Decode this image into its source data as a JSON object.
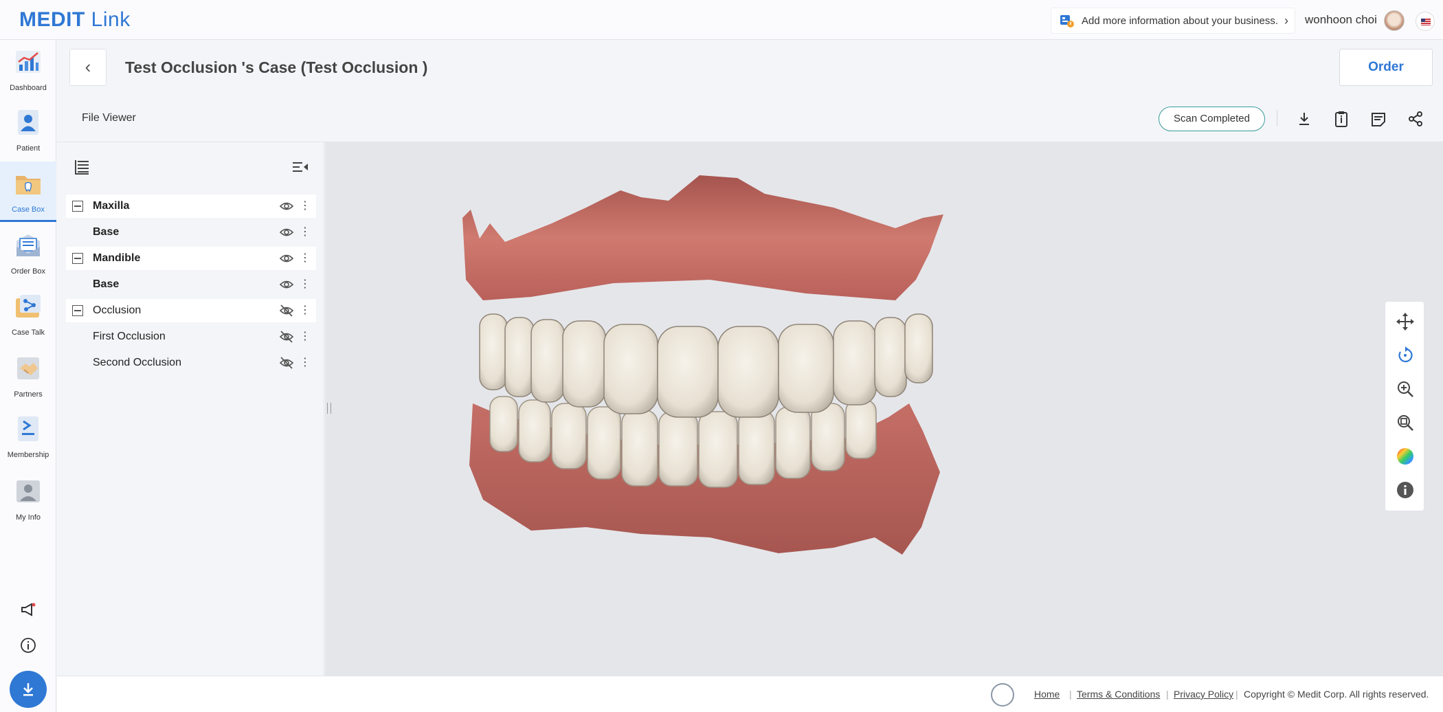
{
  "app": {
    "logo_bold": "MEDIT",
    "logo_light": "Link"
  },
  "topbar": {
    "banner_text": "Add more information about your business.",
    "username": "wonhoon choi"
  },
  "sidebar": {
    "items": [
      {
        "label": "Dashboard",
        "icon": "dashboard-chart-icon"
      },
      {
        "label": "Patient",
        "icon": "patient-icon"
      },
      {
        "label": "Case Box",
        "icon": "case-box-folder-icon"
      },
      {
        "label": "Order Box",
        "icon": "order-box-icon"
      },
      {
        "label": "Case Talk",
        "icon": "case-talk-icon"
      },
      {
        "label": "Partners",
        "icon": "partners-handshake-icon"
      },
      {
        "label": "Membership",
        "icon": "membership-icon"
      },
      {
        "label": "My Info",
        "icon": "my-info-icon"
      }
    ],
    "active": "Case Box"
  },
  "header": {
    "title": "Test Occlusion 's Case (Test Occlusion )",
    "order_label": "Order",
    "section_label": "File Viewer",
    "status": "Scan Completed"
  },
  "tree": [
    {
      "label": "Maxilla",
      "level": 0,
      "bold": true,
      "visible": true
    },
    {
      "label": "Base",
      "level": 1,
      "bold": true,
      "visible": true
    },
    {
      "label": "Mandible",
      "level": 0,
      "bold": true,
      "visible": true
    },
    {
      "label": "Base",
      "level": 1,
      "bold": true,
      "visible": true
    },
    {
      "label": "Occlusion",
      "level": 0,
      "bold": false,
      "visible": false
    },
    {
      "label": "First Occlusion",
      "level": 1,
      "bold": false,
      "visible": false
    },
    {
      "label": "Second Occlusion",
      "level": 1,
      "bold": false,
      "visible": false
    }
  ],
  "viewer_tools": [
    "pan-icon",
    "rotate-icon",
    "zoom-in-icon",
    "zoom-fit-icon",
    "color-map-icon",
    "info-icon"
  ],
  "footer": {
    "home": "Home",
    "terms": "Terms & Conditions",
    "privacy": "Privacy Policy",
    "copyright": "Copyright © Medit Corp. All rights reserved."
  },
  "colors": {
    "accent": "#2f78d4",
    "status_border": "#3a9a9a",
    "gum": "#c46a62",
    "tooth": "#ece6da"
  }
}
